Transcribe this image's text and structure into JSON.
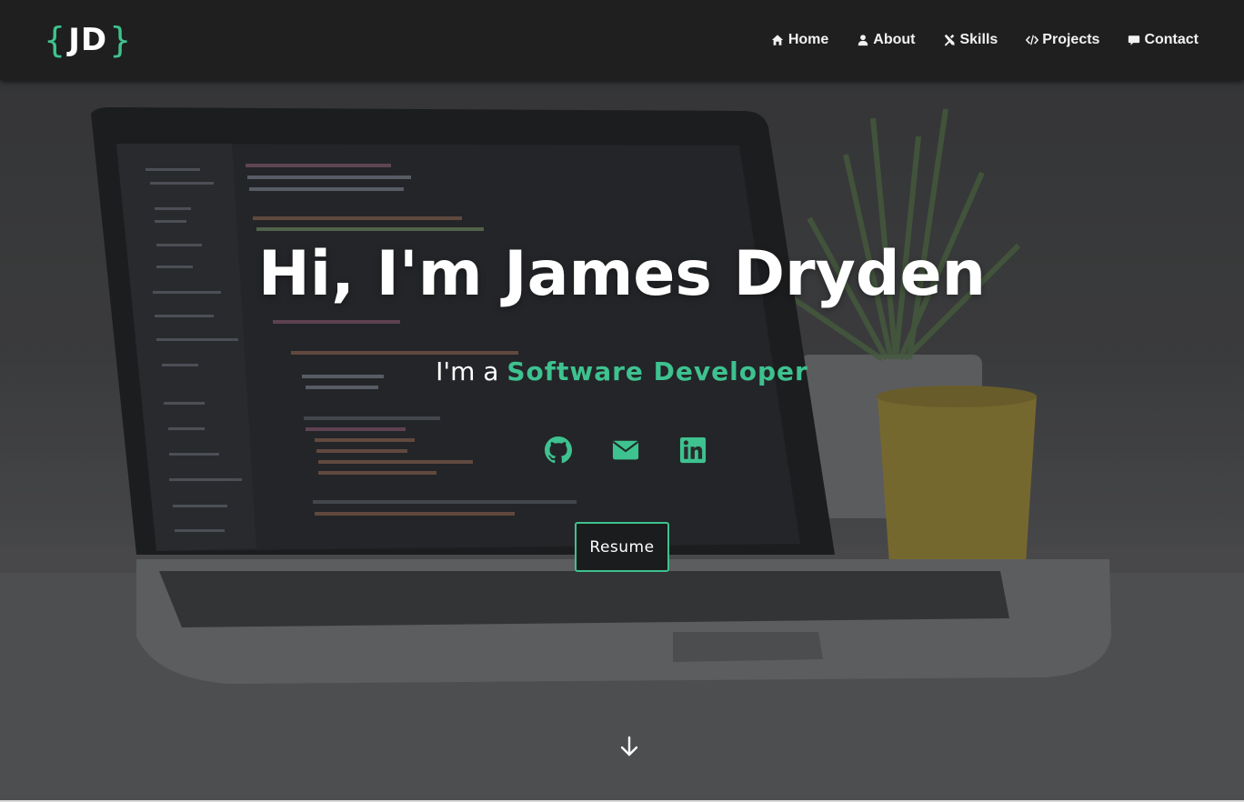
{
  "brand": {
    "open_brace": "{",
    "initials": "JD",
    "close_brace": "}"
  },
  "nav": {
    "items": [
      {
        "label": "Home",
        "icon": "home-icon"
      },
      {
        "label": "About",
        "icon": "user-icon"
      },
      {
        "label": "Skills",
        "icon": "tools-icon"
      },
      {
        "label": "Projects",
        "icon": "code-icon"
      },
      {
        "label": "Contact",
        "icon": "comment-icon"
      }
    ]
  },
  "hero": {
    "headline": "Hi, I'm James Dryden",
    "subline_prefix": "I'm a ",
    "role": "Software Developer",
    "socials": [
      "github-icon",
      "envelope-icon",
      "linkedin-icon"
    ],
    "resume_label": "Resume",
    "scroll_icon": "arrow-down-icon"
  },
  "colors": {
    "accent": "#3ec28f",
    "navbar": "#1f1f20",
    "text": "#ffffff"
  }
}
